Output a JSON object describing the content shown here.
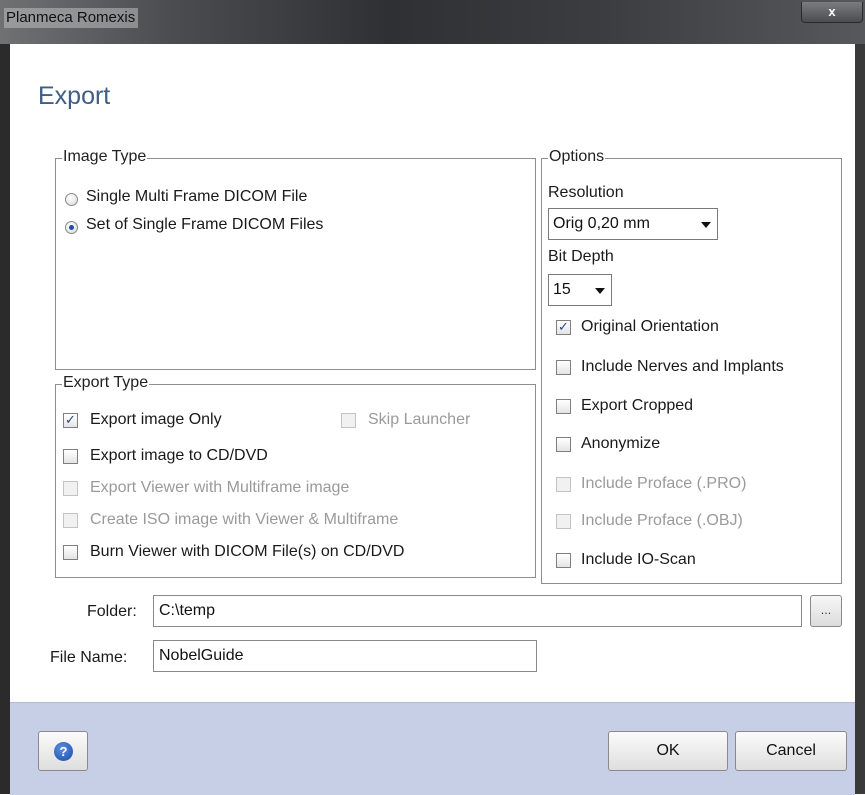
{
  "window": {
    "title": "Planmeca Romexis",
    "close_label": "x"
  },
  "dialog": {
    "heading": "Export"
  },
  "image_type": {
    "legend": "Image Type",
    "options": [
      {
        "label": "Single Multi Frame DICOM File",
        "selected": false
      },
      {
        "label": "Set of Single Frame DICOM Files",
        "selected": true
      }
    ]
  },
  "export_type": {
    "legend": "Export Type",
    "items": [
      {
        "label": "Export image Only",
        "checked": true,
        "enabled": true
      },
      {
        "label": "Skip Launcher",
        "checked": false,
        "enabled": false
      },
      {
        "label": "Export image to CD/DVD",
        "checked": false,
        "enabled": true
      },
      {
        "label": "Export Viewer with Multiframe image",
        "checked": false,
        "enabled": false
      },
      {
        "label": "Create ISO image with Viewer & Multiframe",
        "checked": false,
        "enabled": false
      },
      {
        "label": "Burn Viewer with DICOM File(s) on CD/DVD",
        "checked": false,
        "enabled": true
      }
    ]
  },
  "options": {
    "legend": "Options",
    "resolution_label": "Resolution",
    "resolution_value": "Orig 0,20 mm",
    "bitdepth_label": "Bit Depth",
    "bitdepth_value": "15",
    "checks": [
      {
        "label": "Original Orientation",
        "checked": true,
        "enabled": true
      },
      {
        "label": "Include Nerves and Implants",
        "checked": false,
        "enabled": true
      },
      {
        "label": "Export Cropped",
        "checked": false,
        "enabled": true
      },
      {
        "label": "Anonymize",
        "checked": false,
        "enabled": true
      },
      {
        "label": "Include Proface (.PRO)",
        "checked": false,
        "enabled": false
      },
      {
        "label": "Include Proface (.OBJ)",
        "checked": false,
        "enabled": false
      },
      {
        "label": "Include IO-Scan",
        "checked": false,
        "enabled": true
      }
    ]
  },
  "folder": {
    "label": "Folder:",
    "value": "C:\\temp",
    "browse_label": "..."
  },
  "filename": {
    "label": "File Name:",
    "value": "NobelGuide"
  },
  "footer": {
    "help_glyph": "?",
    "ok_label": "OK",
    "cancel_label": "Cancel"
  }
}
